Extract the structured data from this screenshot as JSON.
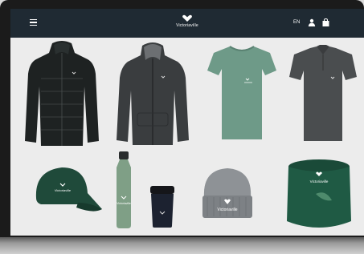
{
  "app": {
    "brand_name": "Victoriaville",
    "language": "EN",
    "icons": {
      "menu": "hamburger-menu-icon",
      "account": "user-icon",
      "cart": "shopping-bag-icon",
      "logo": "heart-emblem-logo"
    }
  },
  "catalog": {
    "products": [
      {
        "id": "puffer-jacket",
        "name": "Puffer jacket",
        "color": "#1e2222"
      },
      {
        "id": "hoodie",
        "name": "Zip hoodie",
        "color": "#3a3d3f"
      },
      {
        "id": "womens-tee",
        "name": "Women's t-shirt",
        "color": "#6e9a88"
      },
      {
        "id": "polo",
        "name": "Polo shirt",
        "color": "#4a4d4f"
      },
      {
        "id": "cap",
        "name": "Cap",
        "color": "#1f4a3a",
        "print": "Victoriaville"
      },
      {
        "id": "bottle",
        "name": "Water bottle",
        "color": "#7f9f86",
        "print": "Victoriaville"
      },
      {
        "id": "tumbler",
        "name": "Travel mug",
        "color": "#1c2230"
      },
      {
        "id": "beanie",
        "name": "Beanie",
        "color": "#8e9296",
        "print": "Victoriaville"
      },
      {
        "id": "neck-warmer",
        "name": "Neck warmer",
        "color": "#1f5a44",
        "print": "Victoriaville"
      }
    ]
  },
  "theme": {
    "header_bg": "#1f2a33",
    "screen_bg": "#ececec",
    "brand_green": "#1f4a3a"
  }
}
